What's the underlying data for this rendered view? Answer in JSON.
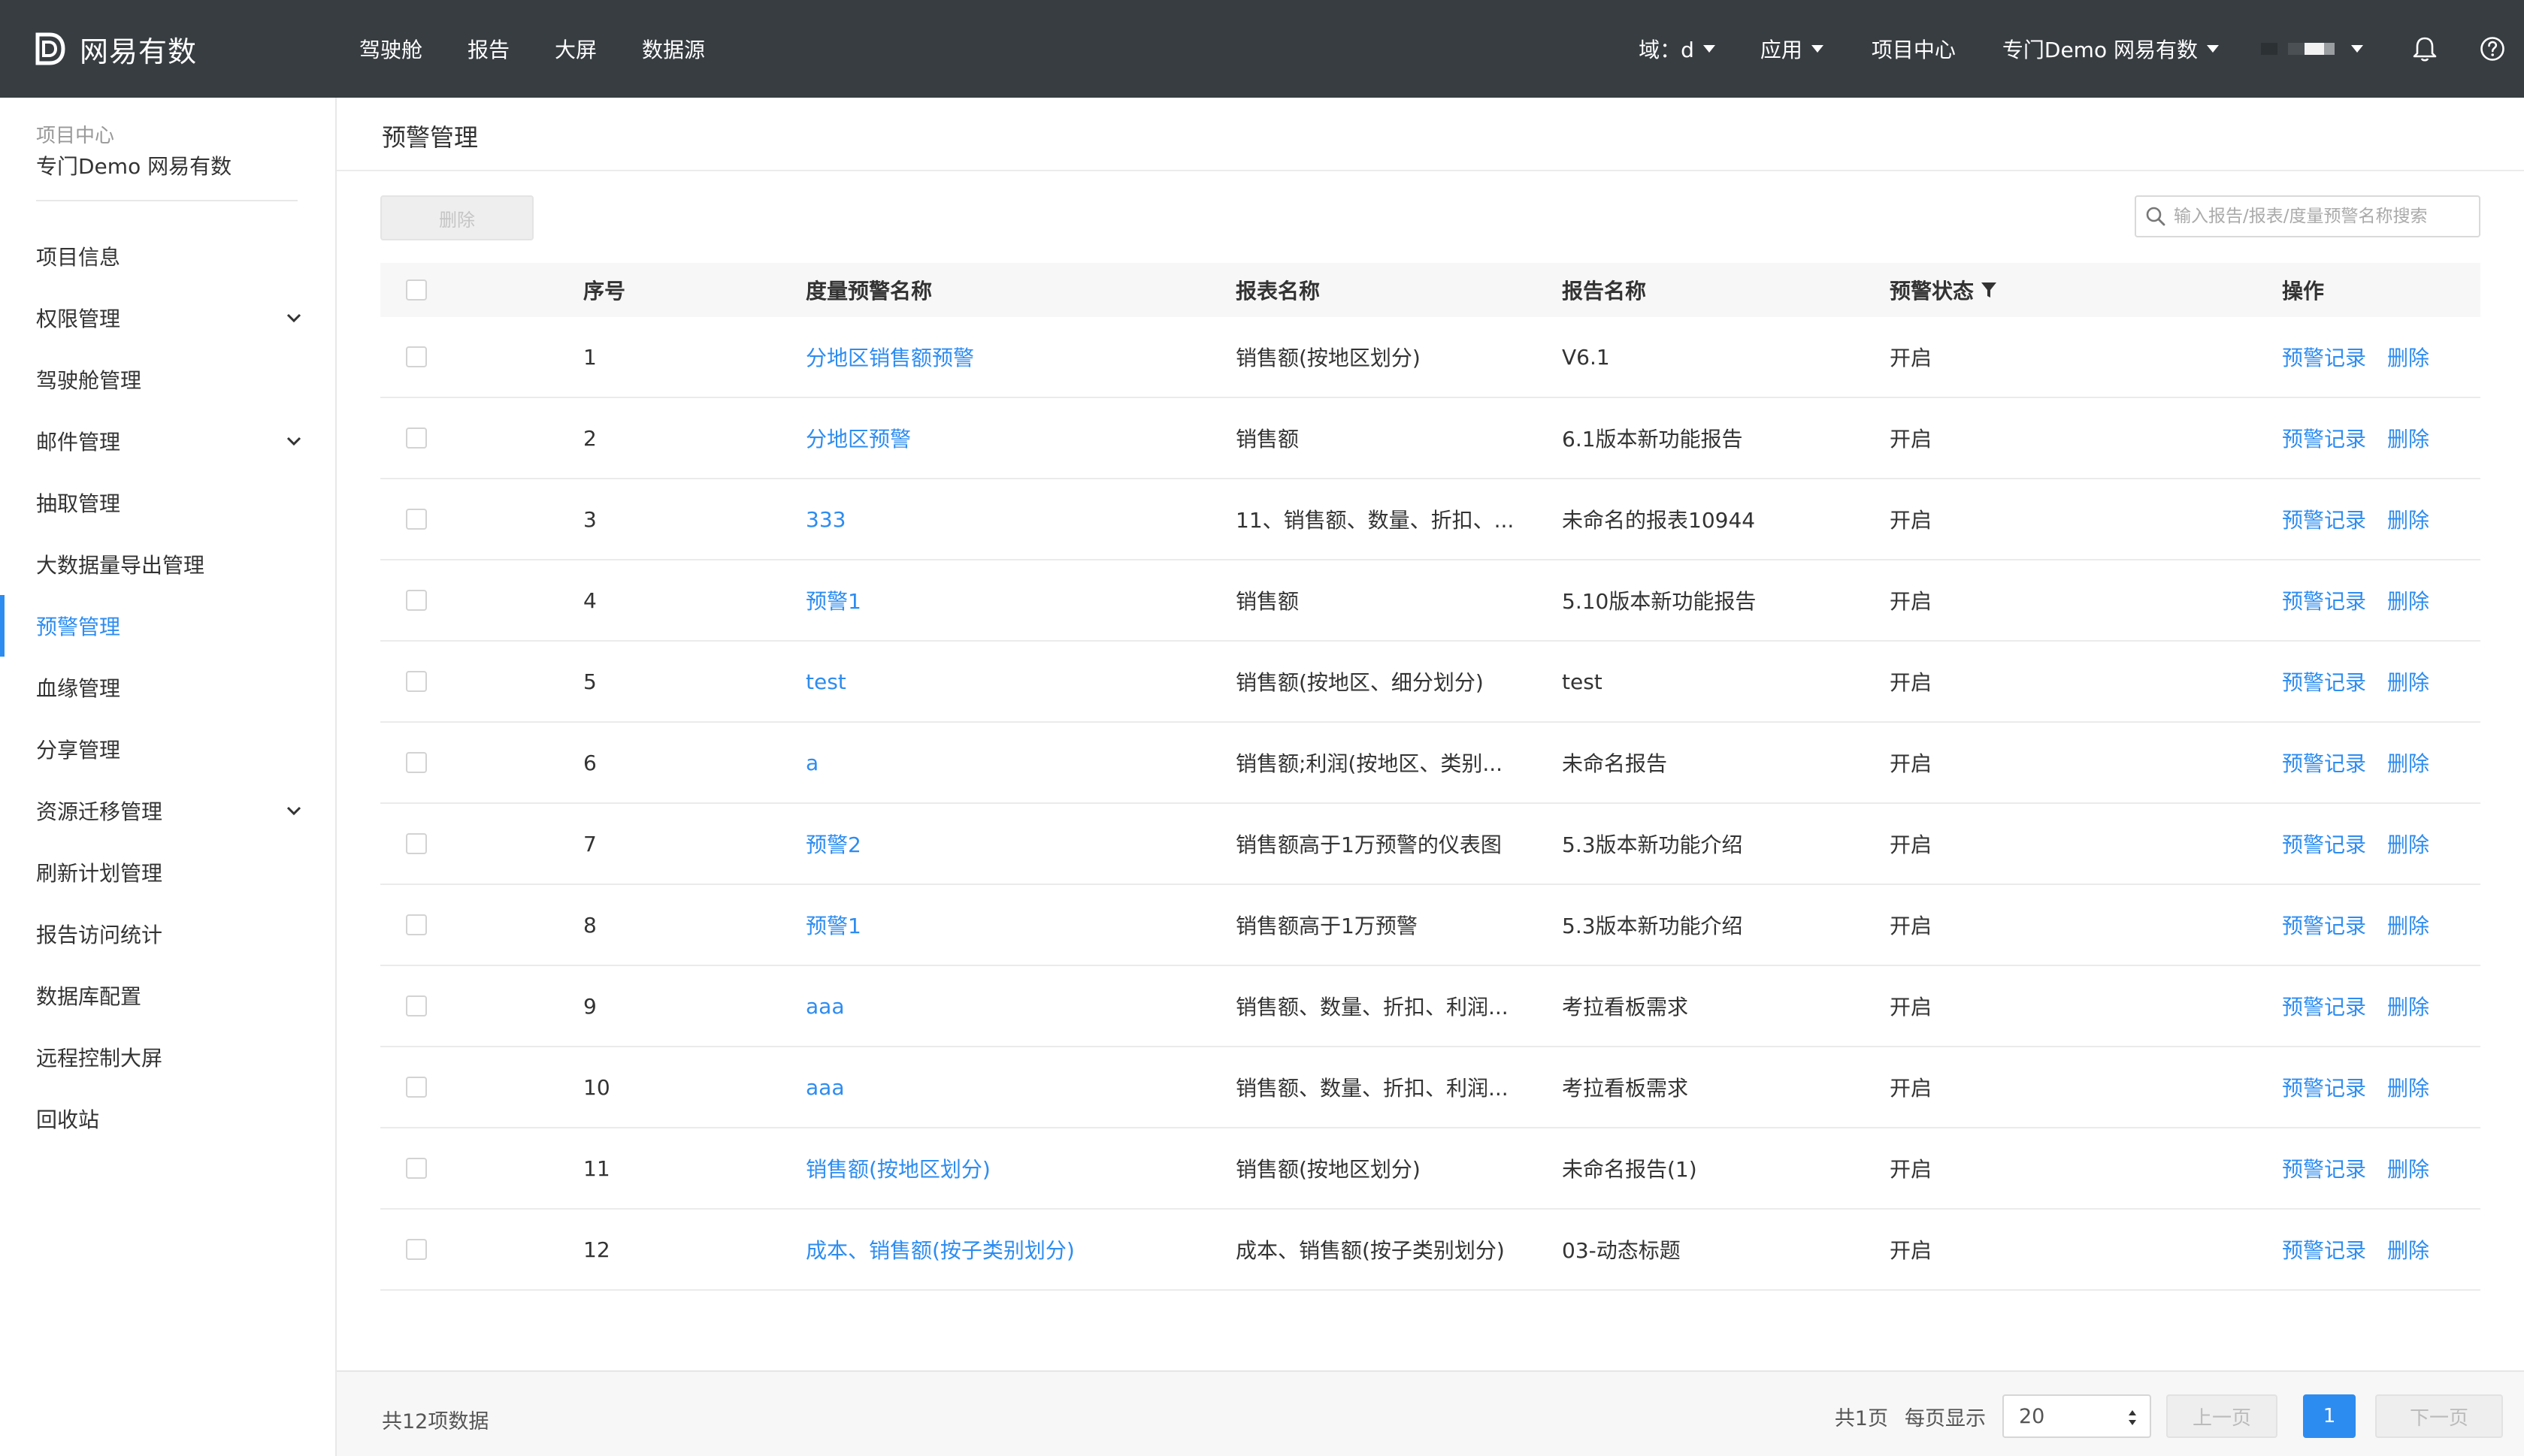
{
  "app": {
    "brand": "网易有数",
    "nav": [
      "驾驶舱",
      "报告",
      "大屏",
      "数据源"
    ],
    "domain_label": "域：d",
    "apps_label": "应用",
    "project_center": "项目中心",
    "project_switch": "专门Demo 网易有数"
  },
  "sidebar": {
    "section_label": "项目中心",
    "project_name": "专门Demo 网易有数",
    "items": [
      {
        "label": "项目信息"
      },
      {
        "label": "权限管理"
      },
      {
        "label": "驾驶舱管理"
      },
      {
        "label": "邮件管理"
      },
      {
        "label": "抽取管理"
      },
      {
        "label": "大数据量导出管理"
      },
      {
        "label": "预警管理"
      },
      {
        "label": "血缘管理"
      },
      {
        "label": "分享管理"
      },
      {
        "label": "资源迁移管理"
      },
      {
        "label": "刷新计划管理"
      },
      {
        "label": "报告访问统计"
      },
      {
        "label": "数据库配置"
      },
      {
        "label": "远程控制大屏"
      },
      {
        "label": "回收站"
      }
    ]
  },
  "main": {
    "title": "预警管理",
    "delete_button": "删除",
    "search_placeholder": "输入报告/报表/度量预警名称搜索"
  },
  "table": {
    "headers": {
      "index": "序号",
      "name": "度量预警名称",
      "sheet": "报表名称",
      "report": "报告名称",
      "status": "预警状态",
      "ops": "操作"
    },
    "action_record": "预警记录",
    "action_delete": "删除",
    "rows": [
      {
        "index": "1",
        "name": "分地区销售额预警",
        "sheet": "销售额(按地区划分)",
        "report": "V6.1",
        "status": "开启"
      },
      {
        "index": "2",
        "name": "分地区预警",
        "sheet": "销售额",
        "report": "6.1版本新功能报告",
        "status": "开启"
      },
      {
        "index": "3",
        "name": "333",
        "sheet": "11、销售额、数量、折扣、...",
        "report": "未命名的报表10944",
        "status": "开启"
      },
      {
        "index": "4",
        "name": "预警1",
        "sheet": "销售额",
        "report": "5.10版本新功能报告",
        "status": "开启"
      },
      {
        "index": "5",
        "name": "test",
        "sheet": "销售额(按地区、细分划分)",
        "report": "test",
        "status": "开启"
      },
      {
        "index": "6",
        "name": "a",
        "sheet": "销售额;利润(按地区、类别...",
        "report": "未命名报告",
        "status": "开启"
      },
      {
        "index": "7",
        "name": "预警2",
        "sheet": "销售额高于1万预警的仪表图",
        "report": "5.3版本新功能介绍",
        "status": "开启"
      },
      {
        "index": "8",
        "name": "预警1",
        "sheet": "销售额高于1万预警",
        "report": "5.3版本新功能介绍",
        "status": "开启"
      },
      {
        "index": "9",
        "name": "aaa",
        "sheet": "销售额、数量、折扣、利润...",
        "report": "考拉看板需求",
        "status": "开启"
      },
      {
        "index": "10",
        "name": "aaa",
        "sheet": "销售额、数量、折扣、利润...",
        "report": "考拉看板需求",
        "status": "开启"
      },
      {
        "index": "11",
        "name": "销售额(按地区划分)",
        "sheet": "销售额(按地区划分)",
        "report": "未命名报告(1)",
        "status": "开启"
      },
      {
        "index": "12",
        "name": "成本、销售额(按子类别划分)",
        "sheet": "成本、销售额(按子类别划分)",
        "report": "03-动态标题",
        "status": "开启"
      }
    ]
  },
  "footer": {
    "total": "共12项数据",
    "pages": "共1页",
    "per_page_label": "每页显示",
    "page_size": "20",
    "prev": "上一页",
    "current": "1",
    "next": "下一页"
  },
  "colors": {
    "topbar": "#373d41",
    "accent": "#2d8cf0"
  }
}
